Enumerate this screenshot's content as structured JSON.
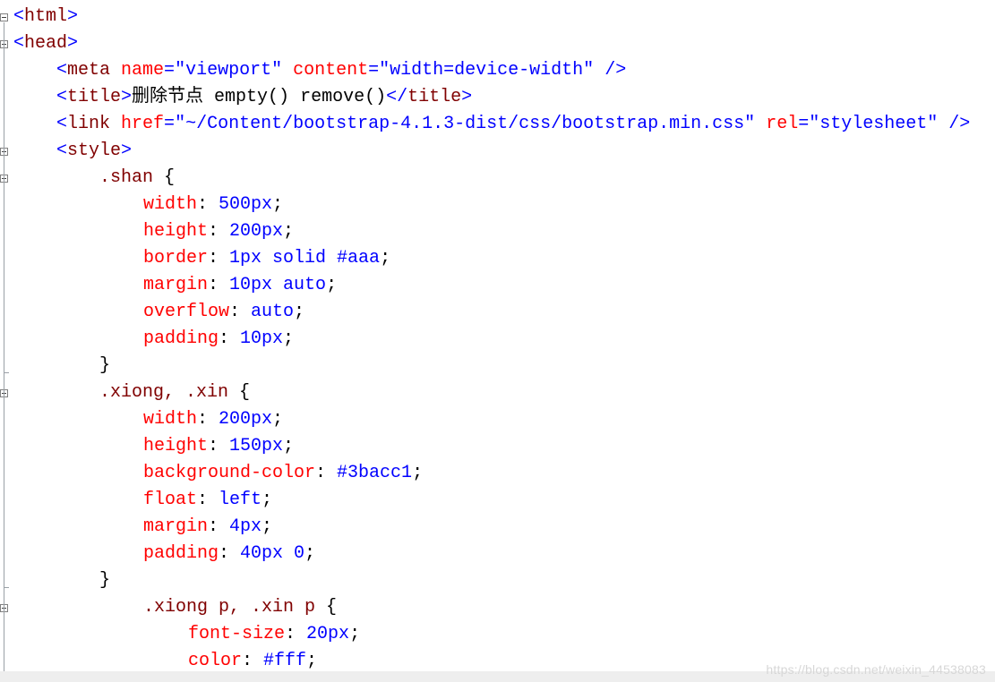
{
  "colors": {
    "bracket": "#0000ff",
    "tag": "#800000",
    "attribute": "#ff0000",
    "value": "#0000ff",
    "text": "#000000",
    "gutter": "#9aa0a6",
    "background": "#ffffff",
    "status_strip": "#eeeeee"
  },
  "icons": {
    "fold": "collapse-minus-box-icon"
  },
  "code": {
    "lines": [
      [
        {
          "t": "<",
          "k": "bracket"
        },
        {
          "t": "html",
          "k": "tag"
        },
        {
          "t": ">",
          "k": "bracket"
        }
      ],
      [
        {
          "t": "<",
          "k": "bracket"
        },
        {
          "t": "head",
          "k": "tag"
        },
        {
          "t": ">",
          "k": "bracket"
        }
      ],
      [
        {
          "t": "<",
          "k": "bracket"
        },
        {
          "t": "meta ",
          "k": "tag"
        },
        {
          "t": "name",
          "k": "attr"
        },
        {
          "t": "=",
          "k": "bracket"
        },
        {
          "t": "\"viewport\"",
          "k": "value"
        },
        {
          "t": " ",
          "k": "text"
        },
        {
          "t": "content",
          "k": "attr"
        },
        {
          "t": "=",
          "k": "bracket"
        },
        {
          "t": "\"width=device-width\"",
          "k": "value"
        },
        {
          "t": " />",
          "k": "bracket"
        }
      ],
      [
        {
          "t": "<",
          "k": "bracket"
        },
        {
          "t": "title",
          "k": "tag"
        },
        {
          "t": ">",
          "k": "bracket"
        },
        {
          "t": "删除节点 empty() remove()",
          "k": "text"
        },
        {
          "t": "</",
          "k": "bracket"
        },
        {
          "t": "title",
          "k": "tag"
        },
        {
          "t": ">",
          "k": "bracket"
        }
      ],
      [
        {
          "t": "<",
          "k": "bracket"
        },
        {
          "t": "link ",
          "k": "tag"
        },
        {
          "t": "href",
          "k": "attr"
        },
        {
          "t": "=",
          "k": "bracket"
        },
        {
          "t": "\"~/Content/bootstrap-4.1.3-dist/css/bootstrap.min.css\"",
          "k": "value"
        },
        {
          "t": " ",
          "k": "text"
        },
        {
          "t": "rel",
          "k": "attr"
        },
        {
          "t": "=",
          "k": "bracket"
        },
        {
          "t": "\"stylesheet\"",
          "k": "value"
        },
        {
          "t": " />",
          "k": "bracket"
        }
      ],
      [
        {
          "t": "<",
          "k": "bracket"
        },
        {
          "t": "style",
          "k": "tag"
        },
        {
          "t": ">",
          "k": "bracket"
        }
      ],
      [
        {
          "t": ".shan ",
          "k": "tag"
        },
        {
          "t": "{",
          "k": "text"
        }
      ],
      [
        {
          "t": "width",
          "k": "attr"
        },
        {
          "t": ": ",
          "k": "text"
        },
        {
          "t": "500px",
          "k": "value"
        },
        {
          "t": ";",
          "k": "text"
        }
      ],
      [
        {
          "t": "height",
          "k": "attr"
        },
        {
          "t": ": ",
          "k": "text"
        },
        {
          "t": "200px",
          "k": "value"
        },
        {
          "t": ";",
          "k": "text"
        }
      ],
      [
        {
          "t": "border",
          "k": "attr"
        },
        {
          "t": ": ",
          "k": "text"
        },
        {
          "t": "1px solid #aaa",
          "k": "value"
        },
        {
          "t": ";",
          "k": "text"
        }
      ],
      [
        {
          "t": "margin",
          "k": "attr"
        },
        {
          "t": ": ",
          "k": "text"
        },
        {
          "t": "10px auto",
          "k": "value"
        },
        {
          "t": ";",
          "k": "text"
        }
      ],
      [
        {
          "t": "overflow",
          "k": "attr"
        },
        {
          "t": ": ",
          "k": "text"
        },
        {
          "t": "auto",
          "k": "value"
        },
        {
          "t": ";",
          "k": "text"
        }
      ],
      [
        {
          "t": "padding",
          "k": "attr"
        },
        {
          "t": ": ",
          "k": "text"
        },
        {
          "t": "10px",
          "k": "value"
        },
        {
          "t": ";",
          "k": "text"
        }
      ],
      [
        {
          "t": "}",
          "k": "text"
        }
      ],
      [
        {
          "t": ".xiong, .xin ",
          "k": "tag"
        },
        {
          "t": "{",
          "k": "text"
        }
      ],
      [
        {
          "t": "width",
          "k": "attr"
        },
        {
          "t": ": ",
          "k": "text"
        },
        {
          "t": "200px",
          "k": "value"
        },
        {
          "t": ";",
          "k": "text"
        }
      ],
      [
        {
          "t": "height",
          "k": "attr"
        },
        {
          "t": ": ",
          "k": "text"
        },
        {
          "t": "150px",
          "k": "value"
        },
        {
          "t": ";",
          "k": "text"
        }
      ],
      [
        {
          "t": "background-color",
          "k": "attr"
        },
        {
          "t": ": ",
          "k": "text"
        },
        {
          "t": "#3bacc1",
          "k": "value"
        },
        {
          "t": ";",
          "k": "text"
        }
      ],
      [
        {
          "t": "float",
          "k": "attr"
        },
        {
          "t": ": ",
          "k": "text"
        },
        {
          "t": "left",
          "k": "value"
        },
        {
          "t": ";",
          "k": "text"
        }
      ],
      [
        {
          "t": "margin",
          "k": "attr"
        },
        {
          "t": ": ",
          "k": "text"
        },
        {
          "t": "4px",
          "k": "value"
        },
        {
          "t": ";",
          "k": "text"
        }
      ],
      [
        {
          "t": "padding",
          "k": "attr"
        },
        {
          "t": ": ",
          "k": "text"
        },
        {
          "t": "40px 0",
          "k": "value"
        },
        {
          "t": ";",
          "k": "text"
        }
      ],
      [
        {
          "t": "}",
          "k": "text"
        }
      ],
      [
        {
          "t": ".xiong p, .xin p ",
          "k": "tag"
        },
        {
          "t": "{",
          "k": "text"
        }
      ],
      [
        {
          "t": "font-size",
          "k": "attr"
        },
        {
          "t": ": ",
          "k": "text"
        },
        {
          "t": "20px",
          "k": "value"
        },
        {
          "t": ";",
          "k": "text"
        }
      ],
      [
        {
          "t": "color",
          "k": "attr"
        },
        {
          "t": ": ",
          "k": "text"
        },
        {
          "t": "#fff",
          "k": "value"
        },
        {
          "t": ";",
          "k": "text"
        }
      ]
    ]
  },
  "watermark": "https://blog.csdn.net/weixin_44538083"
}
